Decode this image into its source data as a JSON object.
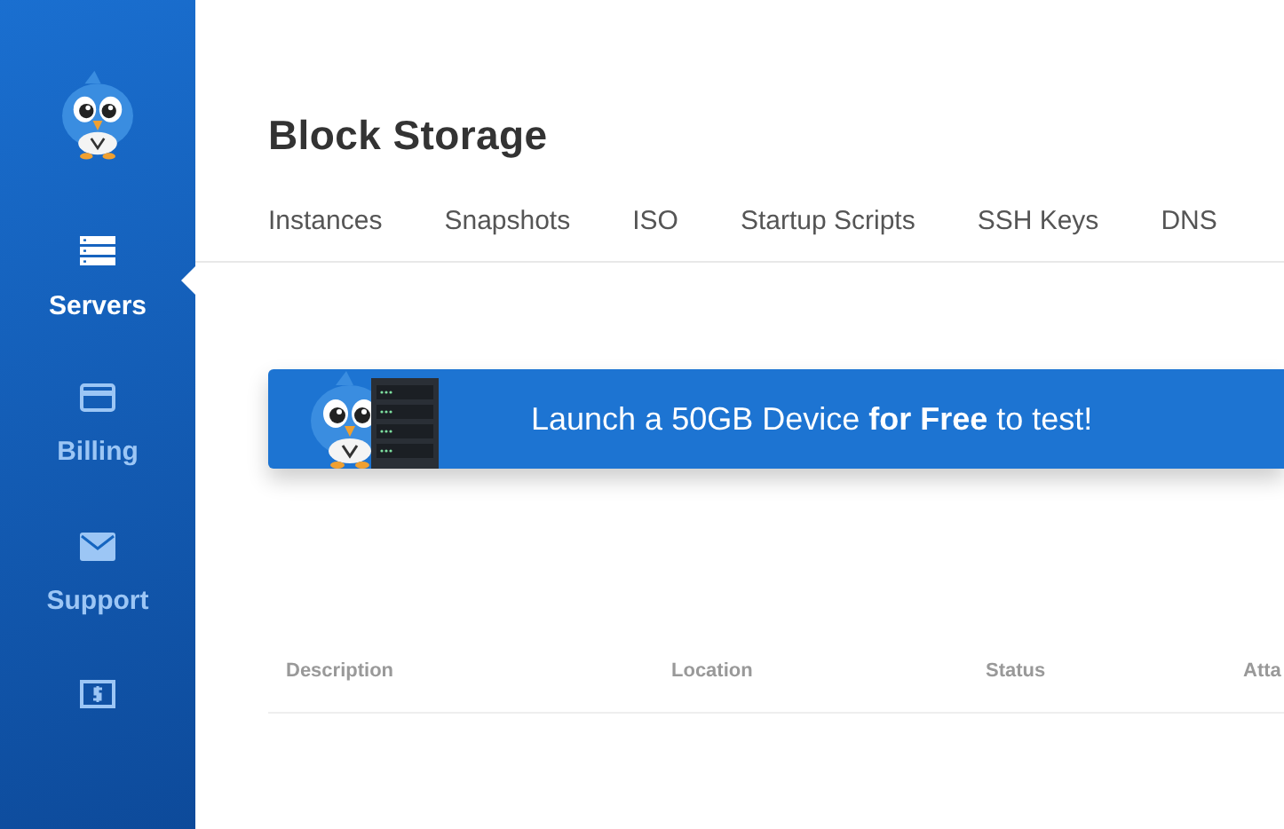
{
  "sidebar": {
    "items": [
      {
        "kind": "servers",
        "label": "Servers",
        "selected": true
      },
      {
        "kind": "billing",
        "label": "Billing",
        "selected": false
      },
      {
        "kind": "support",
        "label": "Support",
        "selected": false
      },
      {
        "kind": "affiliate",
        "selected": false
      }
    ]
  },
  "page": {
    "title": "Block Storage"
  },
  "tabs": [
    "Instances",
    "Snapshots",
    "ISO",
    "Startup Scripts",
    "SSH Keys",
    "DNS"
  ],
  "banner": {
    "text": "Launch a 50GB Device **for Free** to test!"
  },
  "table": {
    "columns": [
      "Description",
      "Location",
      "Status",
      "Atta"
    ]
  }
}
